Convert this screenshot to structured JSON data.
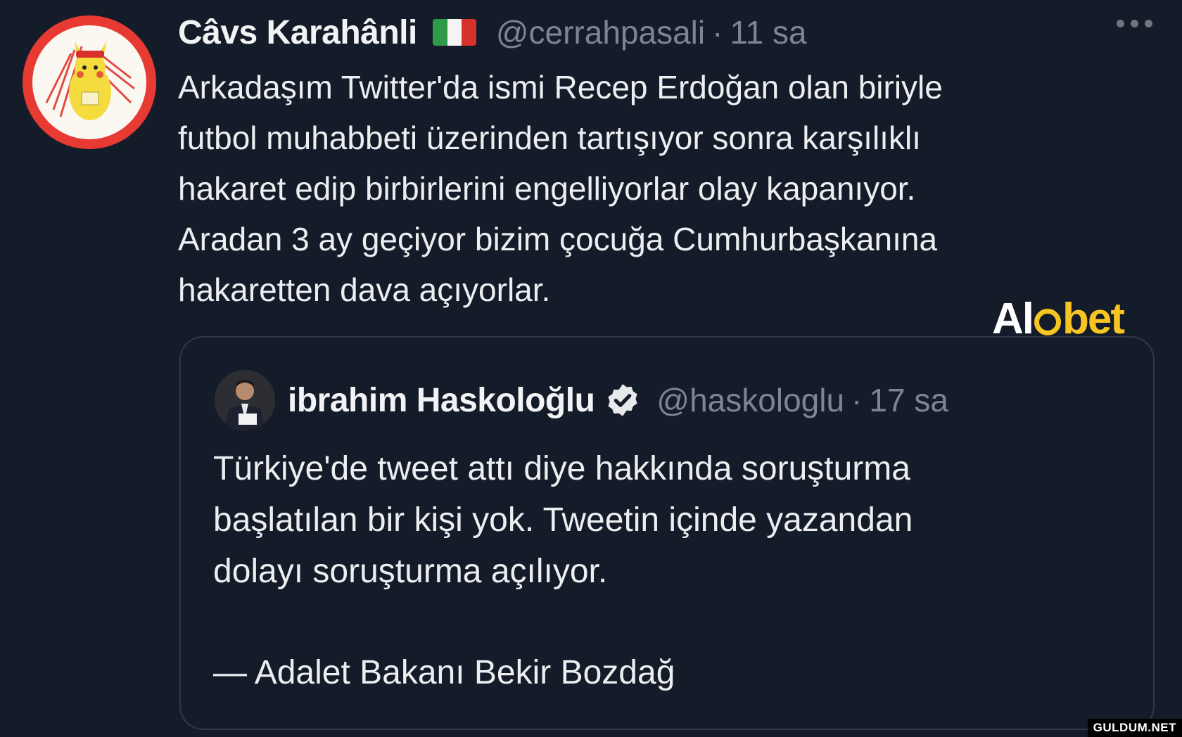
{
  "tweet": {
    "display_name": "Câvs Karahânli",
    "flag_colors": [
      "#2e9a47",
      "#f4f4f4",
      "#d7312c"
    ],
    "handle": "@cerrahpasali",
    "separator": "·",
    "time": "11 sa",
    "more_icon": "more-horizontal-icon",
    "text": "Arkadaşım Twitter'da ismi Recep Erdoğan olan biriyle\nfutbol muhabbeti üzerinden tartışıyor sonra karşılıklı\nhakaret edip birbirlerini engelliyorlar olay kapanıyor.\nAradan 3 ay geçiyor bizim çocuğa Cumhurbaşkanına\nhakaretten dava açıyorlar."
  },
  "quoted_tweet": {
    "display_name": "ibrahim Haskoloğlu",
    "verified_icon": "verified-badge-icon",
    "handle": "@haskologlu",
    "separator": "·",
    "time": "17 sa",
    "text": "Türkiye'de tweet attı diye hakkında soruşturma\nbaşlatılan bir kişi yok. Tweetin içinde yazandan\ndolayı soruşturma açılıyor.",
    "attribution": "—  Adalet Bakanı Bekir Bozdağ"
  },
  "watermark": {
    "part1": "Al",
    "part2": "bet"
  },
  "footer_badge": "GULDUM.NET",
  "colors": {
    "background": "#151c29",
    "muted_text": "#7c8692",
    "avatar_ring": "#e63a33",
    "brand_yellow": "#f7c521"
  }
}
